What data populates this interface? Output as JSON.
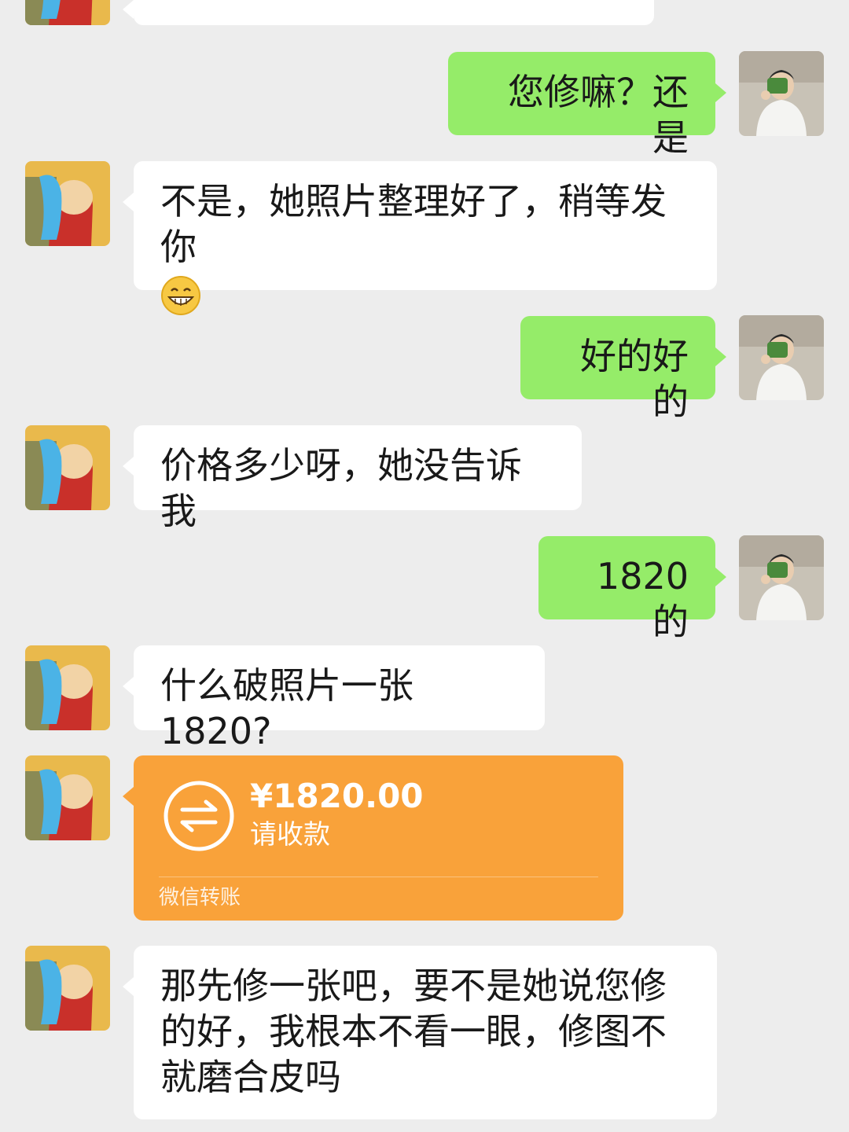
{
  "messages": [
    {
      "side": "left",
      "text": "",
      "partial": true
    },
    {
      "side": "right",
      "text": "您修嘛？还是"
    },
    {
      "side": "left",
      "text": "不是，她照片整理好了，稍等发你",
      "emoji": "grin-emoji"
    },
    {
      "side": "right",
      "text": "好的好的"
    },
    {
      "side": "left",
      "text": "价格多少呀，她没告诉我"
    },
    {
      "side": "right",
      "text": "1820 的"
    },
    {
      "side": "left",
      "text": "什么破照片一张 1820?"
    },
    {
      "side": "left",
      "type": "transfer"
    },
    {
      "side": "left",
      "text": "那先修一张吧，要不是她说您修的好，我根本不看一眼，修图不就磨合皮吗"
    }
  ],
  "transfer": {
    "amount": "¥1820.00",
    "status": "请收款",
    "footer": "微信转账",
    "icon": "transfer-arrows-icon"
  },
  "avatars": {
    "left": "cartoon-avatar-icon",
    "right": "user-photo-avatar-icon"
  },
  "colors": {
    "background": "#ededed",
    "left_bubble": "#ffffff",
    "right_bubble": "#95ec69",
    "transfer": "#f9a23a"
  }
}
